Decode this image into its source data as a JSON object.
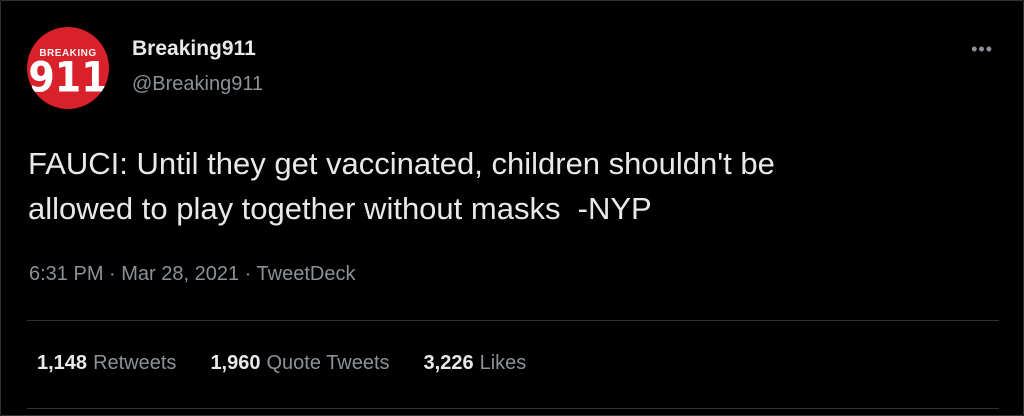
{
  "author": {
    "display_name": "Breaking911",
    "handle": "@Breaking911",
    "avatar_top_text": "BREAKING",
    "avatar_big_text": "911",
    "avatar_color": "#d8212a"
  },
  "more_icon": "more-horizontal-icon",
  "tweet": {
    "text": "FAUCI: Until they get vaccinated, children shouldn't be\nallowed to play together without masks  -NYP",
    "time": "6:31 PM",
    "date": "Mar 28, 2021",
    "source": "TweetDeck",
    "separator": " · "
  },
  "stats": {
    "retweets": {
      "count": "1,148",
      "label": "Retweets"
    },
    "quotes": {
      "count": "1,960",
      "label": "Quote Tweets"
    },
    "likes": {
      "count": "3,226",
      "label": "Likes"
    }
  },
  "colors": {
    "background": "#000000",
    "text": "#e7e9ea",
    "secondary": "#8b9196",
    "divider": "#2f3336"
  }
}
